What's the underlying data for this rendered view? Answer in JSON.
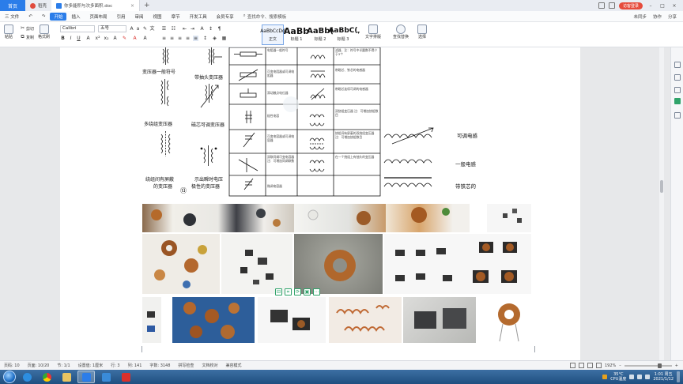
{
  "titlebar": {
    "home_tab": "首页",
    "tabs": [
      {
        "label": "稻壳",
        "active": false
      },
      {
        "label": "你多能积与次多面积.doc",
        "active": true
      }
    ],
    "login": "访客登录"
  },
  "menubar": {
    "file": "三 文件",
    "items": [
      "开始",
      "插入",
      "页面布局",
      "引用",
      "审阅",
      "视图",
      "章节",
      "开发工具",
      "会员专享"
    ],
    "active": "开始",
    "search": "查找命令、搜索模板",
    "right": [
      "未同步",
      "协作",
      "分享"
    ]
  },
  "ribbon": {
    "paste": "粘贴",
    "format_painter": "格式刷",
    "cut": "剪切",
    "copy": "复制",
    "font_name": "Calibri",
    "font_size": "五号",
    "styles": [
      {
        "sample": "AaBbCcDd",
        "name": "正文"
      },
      {
        "sample": "AaBb",
        "name": "标题 1"
      },
      {
        "sample": "AaBb(",
        "name": "标题 2"
      },
      {
        "sample": "AaBbC(",
        "name": "标题 3"
      }
    ],
    "text_layout": "文字排版",
    "find_replace": "查找替换",
    "select": "选择"
  },
  "document": {
    "symbol_labels": {
      "general": "变压器一般符号",
      "tapped": "带抽头变压器",
      "multi": "多绕组变压器",
      "adjustable_core": "磁芯可调变压器",
      "shielded_line1": "绕组间有屏蔽",
      "shielded_line2": "的变压器",
      "polarity_line1": "示出瞬时电压",
      "polarity_line2": "极性的变压器",
      "circle_num": "⑬"
    },
    "table_cells": [
      {
        "a": "电阻器一般符号",
        "b": "滤器、注：符号中半圆数不得少于3个"
      },
      {
        "a": "可变电阻器或可调电阻器",
        "b": "带磁芯、铁芯的电感器"
      },
      {
        "a": "滑动触点电位器",
        "b": "带磁芯连续可调的电感器"
      },
      {
        "a": "极性电容",
        "b": "双绕组变压器 注：可增加绕组数目"
      },
      {
        "a": "可变电容器或可调电容器",
        "b": "绕组间有屏蔽的双绕组变压器 注：可增加绕组数目"
      },
      {
        "a": "双联同调可变电容器 注：可增加同调联数",
        "b": "在一个绕组上有抽头的变压器"
      },
      {
        "a": "微调电容器",
        "b": ""
      }
    ],
    "coil_labels": [
      "可调电感",
      "一般电感",
      "带铁芯的"
    ]
  },
  "statusbar": {
    "page": "页码: 10",
    "pages": "页面: 10/20",
    "section": "节: 1/1",
    "setting": "设置值: 1厘米",
    "row": "行: 3",
    "col": "列: 141",
    "words": "字数: 3148",
    "spell": "拼写检查",
    "proof": "文档校对",
    "mode": "兼容模式",
    "zoom": "192%"
  },
  "taskbar": {
    "temp": "35°C",
    "cpu": "CPU温度",
    "time": "1:01 周五",
    "date": "2021/1/12"
  },
  "colors": {
    "accent": "#2b7de9",
    "login": "#e64b3c",
    "taskbar": "#1f4f80"
  }
}
